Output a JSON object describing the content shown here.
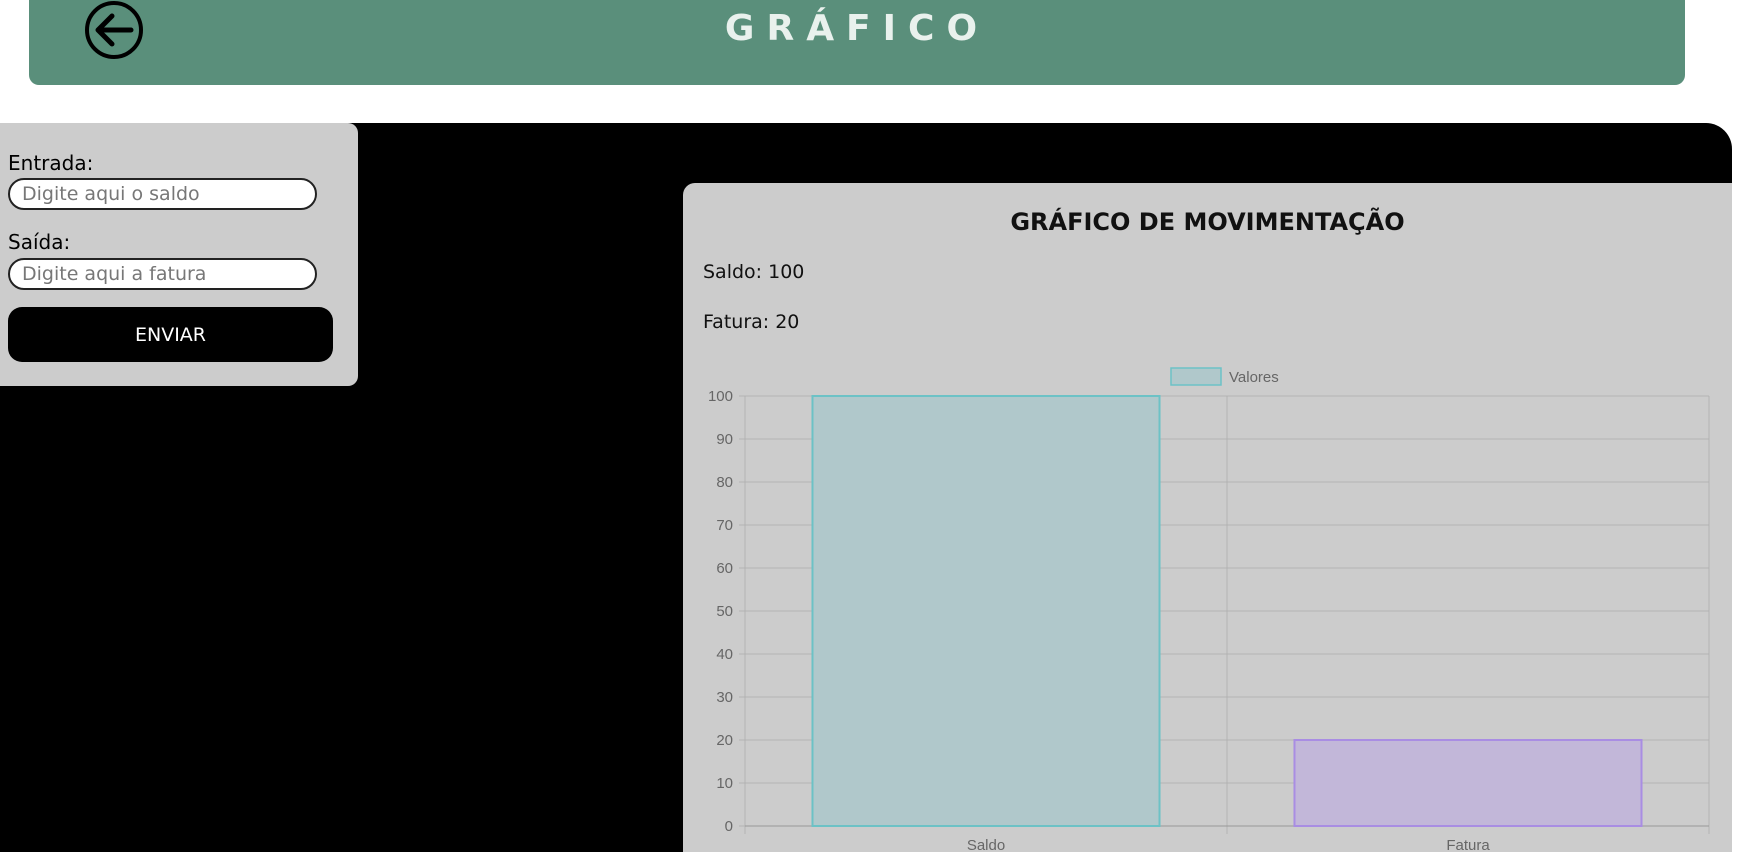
{
  "header": {
    "title": "GRÁFICO",
    "back_icon": "arrow-left-circle-icon",
    "background": "#5a8f7b"
  },
  "form": {
    "entrada_label": "Entrada:",
    "entrada_placeholder": "Digite aqui o saldo",
    "entrada_value": "",
    "saida_label": "Saída:",
    "saida_placeholder": "Digite aqui a fatura",
    "saida_value": "",
    "submit_label": "ENVIAR"
  },
  "chart_card": {
    "title": "GRÁFICO DE MOVIMENTAÇÃO",
    "saldo_line": "Saldo: 100",
    "fatura_line": "Fatura: 20"
  },
  "chart_data": {
    "type": "bar",
    "categories": [
      "Saldo",
      "Fatura"
    ],
    "series": [
      {
        "name": "Valores",
        "values": [
          100,
          20
        ],
        "colors": [
          "#b0c8cb",
          "#c2b7d9"
        ],
        "border_colors": [
          "#6cc2c6",
          "#a98de3"
        ]
      }
    ],
    "ylim": [
      0,
      100
    ],
    "yticks": [
      0,
      10,
      20,
      30,
      40,
      50,
      60,
      70,
      80,
      90,
      100
    ],
    "grid": true,
    "legend_position": "top-center",
    "legend_swatch": "#b0c8cb"
  }
}
